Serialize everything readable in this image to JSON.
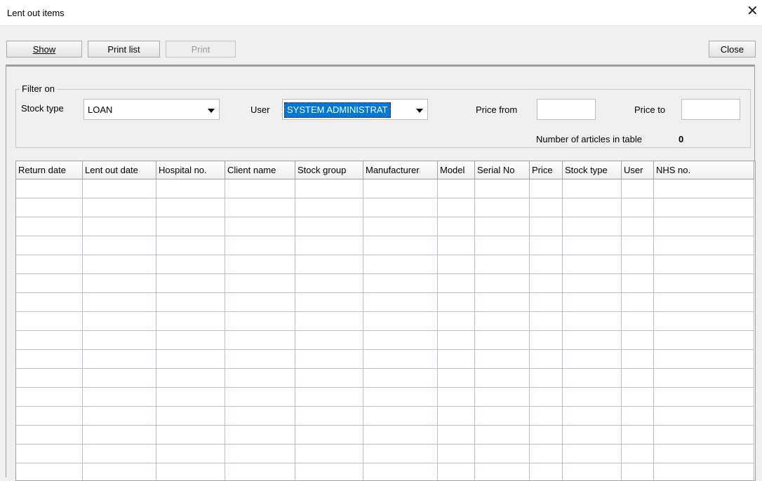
{
  "window": {
    "title": "Lent out items",
    "close_glyph": "✕"
  },
  "toolbar": {
    "show_label": "Show",
    "print_list_label": "Print list",
    "print_label": "Print",
    "close_label": "Close"
  },
  "filter": {
    "group_label": "Filter on",
    "stock_type_label": "Stock type",
    "stock_type_value": "LOAN",
    "user_label": "User",
    "user_value": "SYSTEM ADMINISTRAT",
    "price_from_label": "Price from",
    "price_from_value": "",
    "price_to_label": "Price to",
    "price_to_value": "",
    "count_label": "Number of articles in table",
    "count_value": "0"
  },
  "table": {
    "columns": [
      "Return date",
      "Lent out date",
      "Hospital no.",
      "Client name",
      "Stock group",
      "Manufacturer",
      "Model",
      "Serial No",
      "Price",
      "Stock type",
      "User",
      "NHS no."
    ],
    "rows": []
  },
  "colors": {
    "selection": "#0078d7",
    "grid_line": "#b8bfd0",
    "window_bg": "#f0f0f0"
  }
}
